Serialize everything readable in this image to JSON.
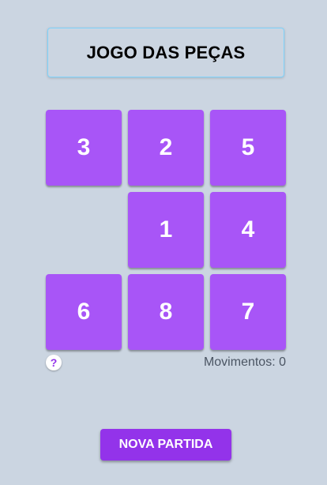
{
  "header": {
    "title": "JOGO DAS PEÇAS"
  },
  "board": {
    "rows": 3,
    "cols": 3,
    "tiles": [
      "3",
      "2",
      "5",
      "",
      "1",
      "4",
      "6",
      "8",
      "7"
    ]
  },
  "footer": {
    "help_label": "?",
    "moves_text": "Movimentos: 0"
  },
  "actions": {
    "new_game_label": "NOVA PARTIDA"
  },
  "colors": {
    "background": "#cbd5e1",
    "tile": "#a855f7",
    "button": "#9333ea",
    "title_border": "#7dd3fc"
  }
}
